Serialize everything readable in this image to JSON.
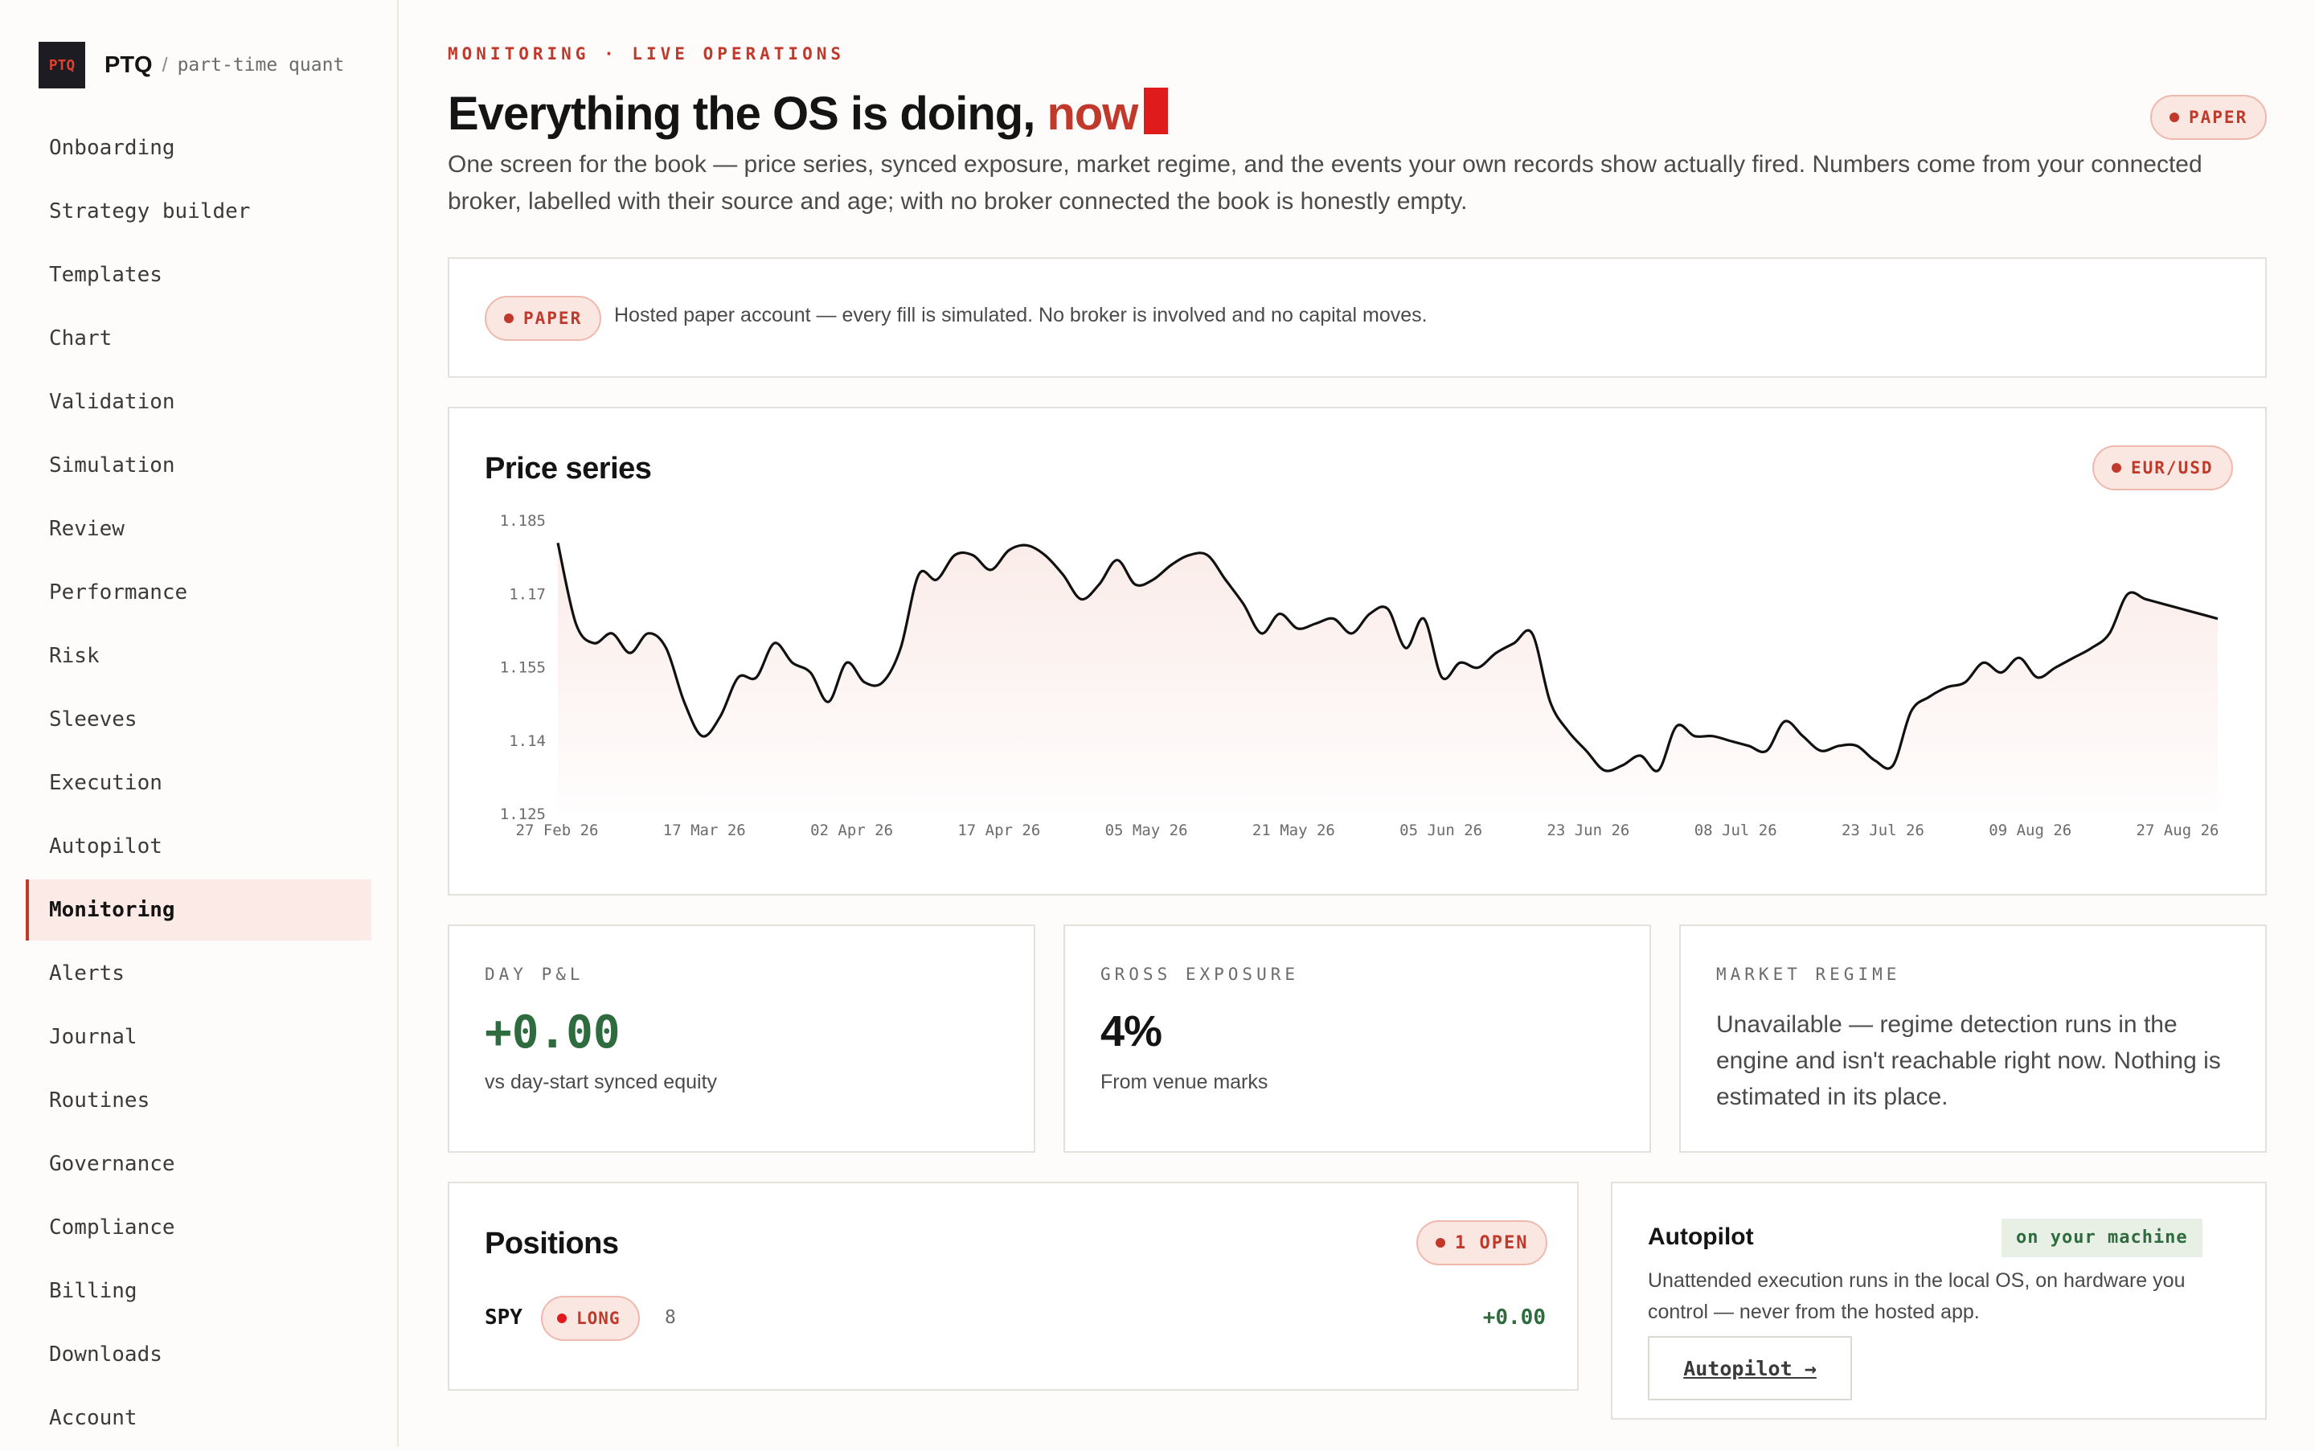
{
  "brand": {
    "logo": "PTQ",
    "name": "PTQ",
    "separator": "/",
    "tagline": "part-time quant"
  },
  "nav": [
    {
      "label": "Onboarding"
    },
    {
      "label": "Strategy builder"
    },
    {
      "label": "Templates"
    },
    {
      "label": "Chart"
    },
    {
      "label": "Validation"
    },
    {
      "label": "Simulation"
    },
    {
      "label": "Review"
    },
    {
      "label": "Performance"
    },
    {
      "label": "Risk"
    },
    {
      "label": "Sleeves"
    },
    {
      "label": "Execution"
    },
    {
      "label": "Autopilot"
    },
    {
      "label": "Monitoring",
      "active": true
    },
    {
      "label": "Alerts"
    },
    {
      "label": "Journal"
    },
    {
      "label": "Routines"
    },
    {
      "label": "Governance"
    },
    {
      "label": "Compliance"
    },
    {
      "label": "Billing"
    },
    {
      "label": "Downloads"
    },
    {
      "label": "Account"
    }
  ],
  "header": {
    "eyebrow": "MONITORING · LIVE OPERATIONS",
    "title_main": "Everything the OS is doing, ",
    "title_accent": "now",
    "mode_badge": "PAPER",
    "lede": "One screen for the book — price series, synced exposure, market regime, and the events your own records show actually fired. Numbers come from your connected broker, labelled with their source and age; with no broker connected the book is honestly empty."
  },
  "notice": {
    "badge": "PAPER",
    "text": "Hosted paper account — every fill is simulated. No broker is involved and no capital moves."
  },
  "price_card": {
    "title": "Price series",
    "symbol_badge": "EUR/USD"
  },
  "chart_data": {
    "type": "line",
    "title": "Price series",
    "ylim": [
      1.125,
      1.185
    ],
    "yticks": [
      "1.185",
      "1.17",
      "1.155",
      "1.14",
      "1.125"
    ],
    "xticks": [
      "27 Feb 26",
      "17 Mar 26",
      "02 Apr 26",
      "17 Apr 26",
      "05 May 26",
      "21 May 26",
      "05 Jun 26",
      "23 Jun 26",
      "08 Jul 26",
      "23 Jul 26",
      "09 Aug 26",
      "27 Aug 26"
    ],
    "x": [
      "27 Feb 26",
      "28 Feb 26",
      "02 Mar 26",
      "04 Mar 26",
      "05 Mar 26",
      "07 Mar 26",
      "09 Mar 26",
      "10 Mar 26",
      "12 Mar 26",
      "13 Mar 26",
      "15 Mar 26",
      "17 Mar 26",
      "19 Mar 26",
      "21 Mar 26",
      "23 Mar 26",
      "25 Mar 26",
      "27 Mar 26",
      "29 Mar 26",
      "31 Mar 26",
      "02 Apr 26",
      "04 Apr 26",
      "06 Apr 26",
      "08 Apr 26",
      "10 Apr 26",
      "12 Apr 26",
      "14 Apr 26",
      "16 Apr 26",
      "17 Apr 26",
      "19 Apr 26",
      "21 Apr 26",
      "23 Apr 26",
      "25 Apr 26",
      "27 Apr 26",
      "29 Apr 26",
      "01 May 26",
      "03 May 26",
      "05 May 26",
      "07 May 26",
      "09 May 26",
      "11 May 26",
      "13 May 26",
      "15 May 26",
      "17 May 26",
      "19 May 26",
      "21 May 26",
      "23 May 26",
      "25 May 26",
      "27 May 26",
      "29 May 26",
      "31 May 26",
      "02 Jun 26",
      "05 Jun 26",
      "07 Jun 26",
      "09 Jun 26",
      "11 Jun 26",
      "13 Jun 26",
      "15 Jun 26",
      "17 Jun 26",
      "19 Jun 26",
      "21 Jun 26",
      "23 Jun 26",
      "25 Jun 26",
      "27 Jun 26",
      "29 Jun 26",
      "01 Jul 26",
      "03 Jul 26",
      "05 Jul 26",
      "08 Jul 26",
      "10 Jul 26",
      "12 Jul 26",
      "14 Jul 26",
      "16 Jul 26",
      "18 Jul 26",
      "20 Jul 26",
      "23 Jul 26",
      "25 Jul 26",
      "27 Jul 26",
      "29 Jul 26",
      "31 Jul 26",
      "02 Aug 26",
      "04 Aug 26",
      "06 Aug 26",
      "09 Aug 26",
      "11 Aug 26",
      "13 Aug 26",
      "15 Aug 26",
      "17 Aug 26",
      "19 Aug 26",
      "21 Aug 26",
      "23 Aug 26",
      "25 Aug 26",
      "27 Aug 26",
      "29 Aug 26"
    ],
    "series": [
      {
        "values": [
          1.1805,
          1.164,
          1.16,
          1.162,
          1.158,
          1.162,
          1.159,
          1.148,
          1.141,
          1.145,
          1.153,
          1.153,
          1.16,
          1.156,
          1.154,
          1.148,
          1.156,
          1.152,
          1.152,
          1.159,
          1.174,
          1.173,
          1.178,
          1.178,
          1.175,
          1.179,
          1.18,
          1.178,
          1.174,
          1.169,
          1.172,
          1.177,
          1.172,
          1.173,
          1.176,
          1.178,
          1.178,
          1.173,
          1.168,
          1.162,
          1.166,
          1.163,
          1.164,
          1.165,
          1.162,
          1.166,
          1.167,
          1.159,
          1.165,
          1.153,
          1.156,
          1.155,
          1.158,
          1.16,
          1.162,
          1.148,
          1.142,
          1.138,
          1.134,
          1.135,
          1.137,
          1.134,
          1.143,
          1.141,
          1.141,
          1.14,
          1.139,
          1.138,
          1.144,
          1.141,
          1.138,
          1.139,
          1.139,
          1.136,
          1.135,
          1.146,
          1.149,
          1.151,
          1.152,
          1.156,
          1.154,
          1.157,
          1.153,
          1.155,
          1.157,
          1.159,
          1.162,
          1.17,
          1.169,
          1.168,
          1.167,
          1.166,
          1.165
        ]
      }
    ]
  },
  "stats": [
    {
      "label": "DAY P&L",
      "value": "+0.00",
      "sub": "vs day-start synced equity"
    },
    {
      "label": "GROSS EXPOSURE",
      "value": "4%",
      "sub": "From venue marks"
    },
    {
      "label": "MARKET REGIME",
      "text": "Unavailable — regime detection runs in the engine and isn't reachable right now. Nothing is estimated in its place."
    }
  ],
  "positions": {
    "title": "Positions",
    "open_badge": "1 OPEN",
    "rows": [
      {
        "symbol": "SPY",
        "side": "LONG",
        "qty": "8",
        "pnl": "+0.00"
      }
    ]
  },
  "autopilot": {
    "title": "Autopilot",
    "tag": "on your machine",
    "text": "Unattended execution runs in the local OS, on hardware you control — never from the hosted app.",
    "button": "Autopilot →"
  },
  "colors": {
    "accent": "#c0392b",
    "positive": "#2e6b3e",
    "badge_bg": "#fbe7e2",
    "sidebar_active_bg": "#fbeae6"
  }
}
